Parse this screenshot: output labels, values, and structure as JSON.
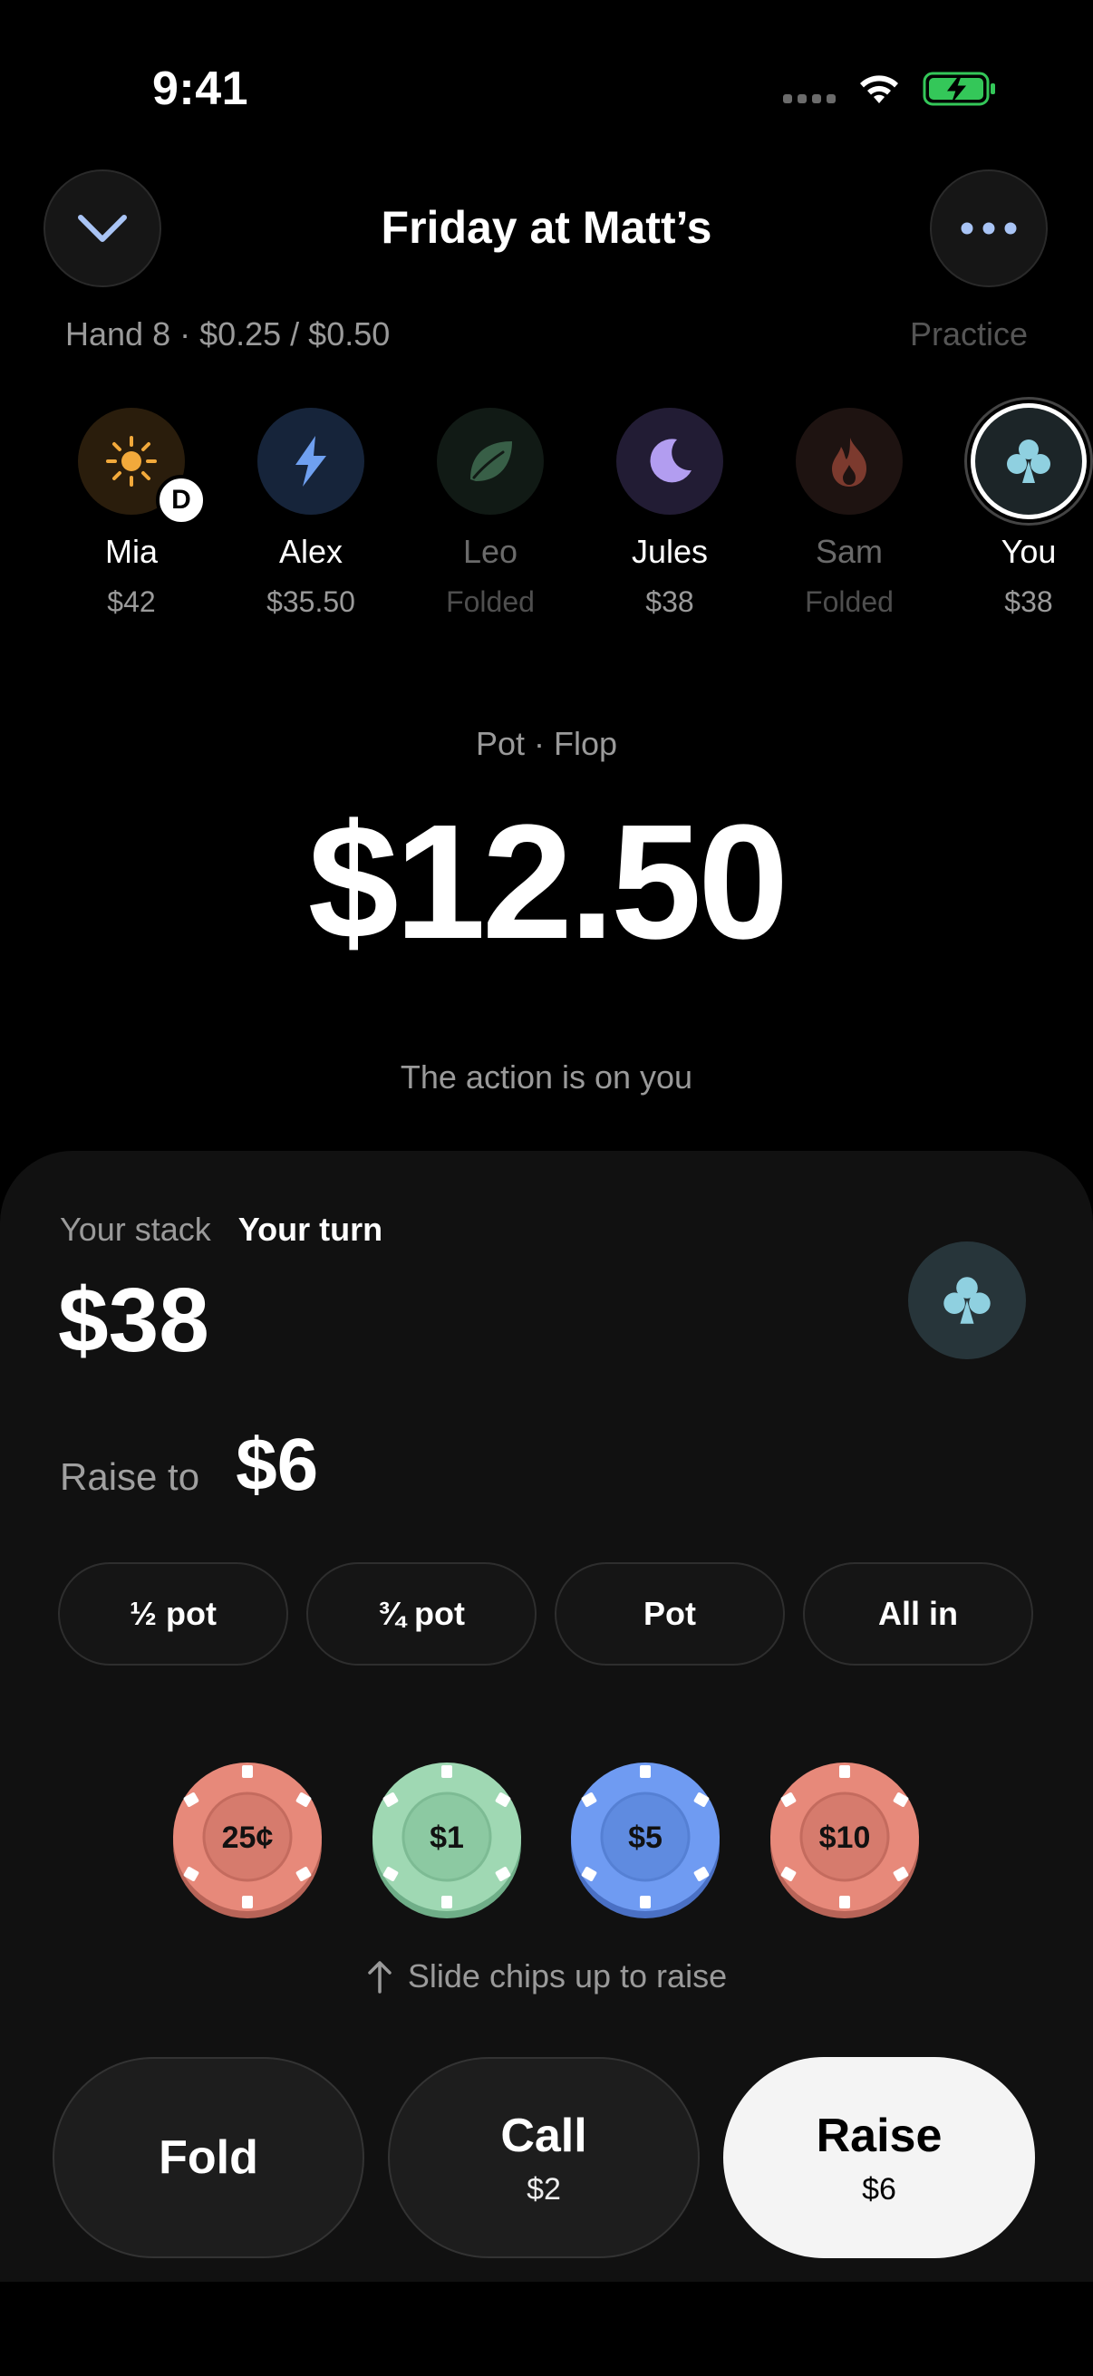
{
  "status": {
    "time": "9:41"
  },
  "header": {
    "title": "Friday at Matt’s",
    "hand_info": "Hand 8 · $0.25 / $0.50",
    "mode": "Practice"
  },
  "players": [
    {
      "name": "Mia",
      "stack": "$42",
      "icon": "sun-icon",
      "dealer_badge": "D"
    },
    {
      "name": "Alex",
      "stack": "$35.50",
      "icon": "lightning-icon"
    },
    {
      "name": "Leo",
      "stack": "Folded",
      "icon": "leaf-icon"
    },
    {
      "name": "Jules",
      "stack": "$38",
      "icon": "moon-icon"
    },
    {
      "name": "Sam",
      "stack": "Folded",
      "icon": "flame-icon"
    },
    {
      "name": "You",
      "stack": "$38",
      "icon": "club-icon"
    }
  ],
  "pot": {
    "label": "Pot · Flop",
    "amount": "$12.50",
    "action_message": "The action is on you"
  },
  "panel": {
    "stack_label": "Your stack",
    "turn_label": "Your turn",
    "stack_amount": "$38",
    "raise_label": "Raise to",
    "raise_amount": "$6",
    "presets": [
      "½ pot",
      "¾ pot",
      "Pot",
      "All in"
    ],
    "chips": [
      {
        "label": "25¢",
        "color": "#e7897a"
      },
      {
        "label": "$1",
        "color": "#9fd8b3"
      },
      {
        "label": "$5",
        "color": "#6f9bf2"
      },
      {
        "label": "$10",
        "color": "#e7897a"
      }
    ],
    "slide_hint": "Slide chips up to raise"
  },
  "actions": {
    "fold": {
      "label": "Fold"
    },
    "call": {
      "label": "Call",
      "amount": "$2"
    },
    "raise": {
      "label": "Raise",
      "amount": "$6"
    }
  },
  "colors": {
    "background": "#000000",
    "panel": "#111111",
    "accent_club": "#8fd0e0",
    "battery": "#34c759"
  }
}
